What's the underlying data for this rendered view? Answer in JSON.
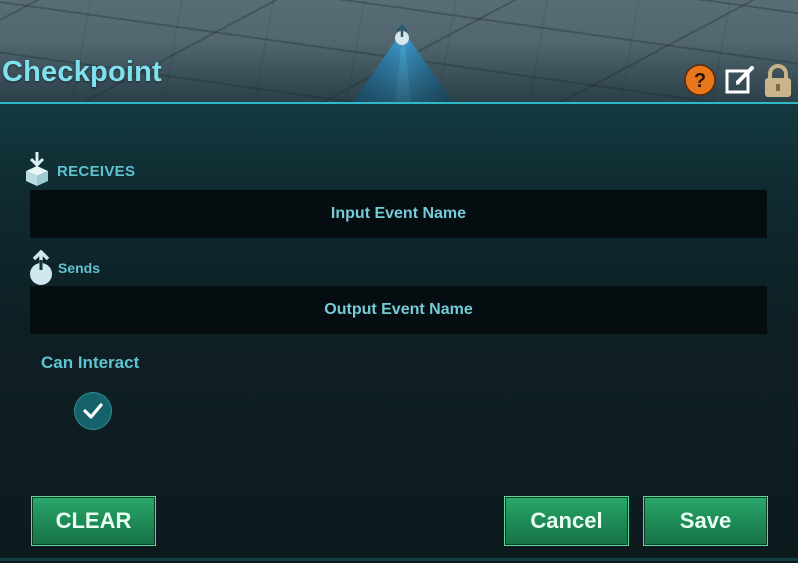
{
  "header": {
    "title": "Checkpoint",
    "icons": [
      "help-icon",
      "edit-icon",
      "lock-icon"
    ],
    "help_icon_color": "#e8761c"
  },
  "receives": {
    "label": "RECEIVES",
    "icon": "receive-box-icon",
    "field_text": "Input Event Name"
  },
  "sends": {
    "label": "Sends",
    "icon": "send-icon",
    "field_text": "Output Event Name"
  },
  "can_interact": {
    "label": "Can Interact",
    "checked": true
  },
  "buttons": {
    "clear": "CLEAR",
    "cancel": "Cancel",
    "save": "Save"
  },
  "colors": {
    "accent": "#5ec3d1",
    "title": "#7fe0ee",
    "button_green": "#1f8e58",
    "field_bg": "#060d10"
  }
}
